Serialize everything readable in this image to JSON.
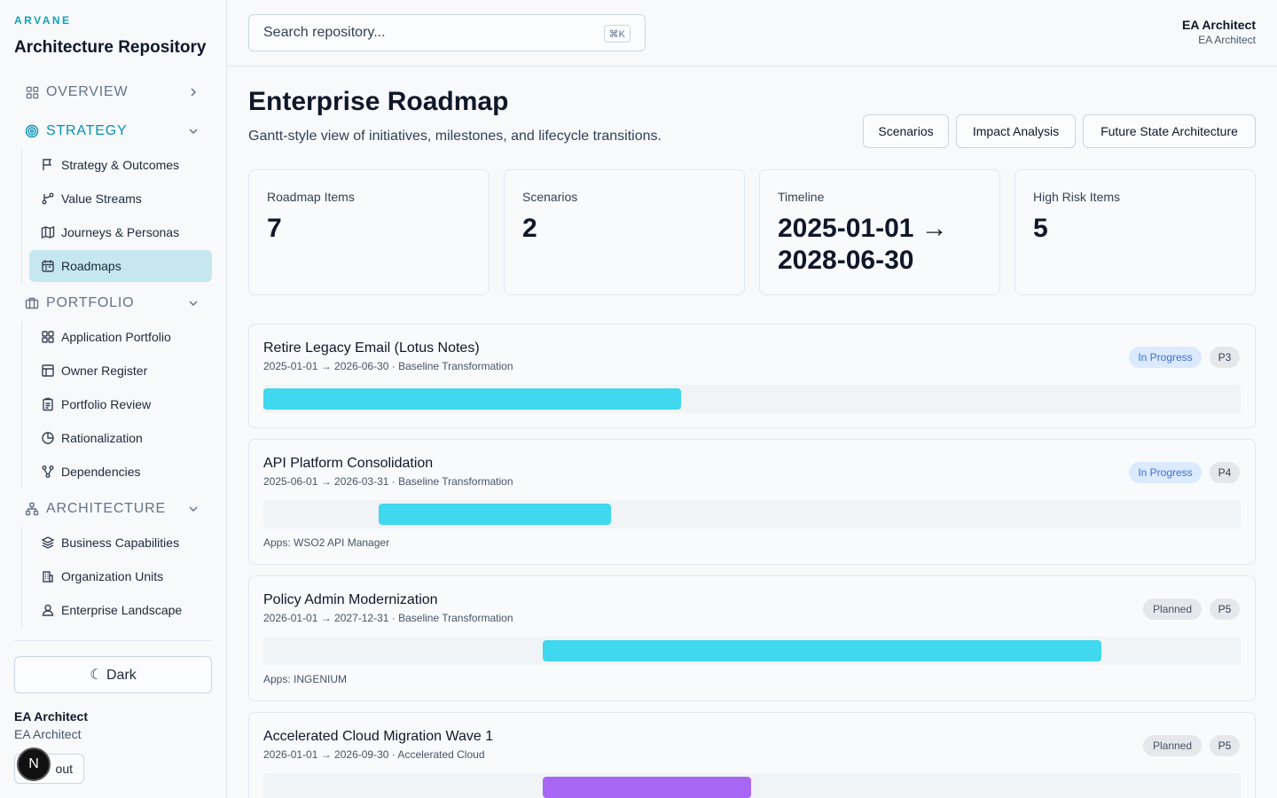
{
  "brand": {
    "small": "ARVANE",
    "title": "Architecture Repository"
  },
  "nav": {
    "overview": "OVERVIEW",
    "strategy": "STRATEGY",
    "strategy_items": [
      "Strategy & Outcomes",
      "Value Streams",
      "Journeys & Personas",
      "Roadmaps"
    ],
    "portfolio": "PORTFOLIO",
    "portfolio_items": [
      "Application Portfolio",
      "Owner Register",
      "Portfolio Review",
      "Rationalization",
      "Dependencies"
    ],
    "architecture": "ARCHITECTURE",
    "architecture_items": [
      "Business Capabilities",
      "Organization Units",
      "Enterprise Landscape"
    ]
  },
  "sidebar_footer": {
    "dark_label": "☾ Dark",
    "user_name": "EA Architect",
    "user_role": "EA Architect",
    "signout_label": "out",
    "badge": "N"
  },
  "search": {
    "placeholder": "Search repository...",
    "shortcut": "⌘K"
  },
  "top_user": {
    "name": "EA Architect",
    "role": "EA Architect"
  },
  "page": {
    "title": "Enterprise Roadmap",
    "subtitle": "Gantt-style view of initiatives, milestones, and lifecycle transitions.",
    "actions": [
      "Scenarios",
      "Impact Analysis",
      "Future State Architecture"
    ]
  },
  "stats": [
    {
      "label": "Roadmap Items",
      "value": "7"
    },
    {
      "label": "Scenarios",
      "value": "2"
    },
    {
      "label": "Timeline",
      "value": "2025-01-01 → 2028-06-30"
    },
    {
      "label": "High Risk Items",
      "value": "5"
    }
  ],
  "roadmap": {
    "timeline_start": "2025-01-01",
    "timeline_end": "2028-06-30",
    "items": [
      {
        "title": "Retire Legacy Email (Lotus Notes)",
        "meta": "2025-01-01 → 2026-06-30 · Baseline Transformation",
        "status": "In Progress",
        "priority": "P3",
        "apps": "",
        "bar_color": "#40d8ee"
      },
      {
        "title": "API Platform Consolidation",
        "meta": "2025-06-01 → 2026-03-31 · Baseline Transformation",
        "status": "In Progress",
        "priority": "P4",
        "apps": "Apps: WSO2 API Manager",
        "bar_color": "#40d8ee"
      },
      {
        "title": "Policy Admin Modernization",
        "meta": "2026-01-01 → 2027-12-31 · Baseline Transformation",
        "status": "Planned",
        "priority": "P5",
        "apps": "Apps: INGENIUM",
        "bar_color": "#40d8ee"
      },
      {
        "title": "Accelerated Cloud Migration Wave 1",
        "meta": "2026-01-01 → 2026-09-30 · Accelerated Cloud",
        "status": "Planned",
        "priority": "P5",
        "apps": "",
        "bar_color": "#a866f5"
      }
    ]
  }
}
